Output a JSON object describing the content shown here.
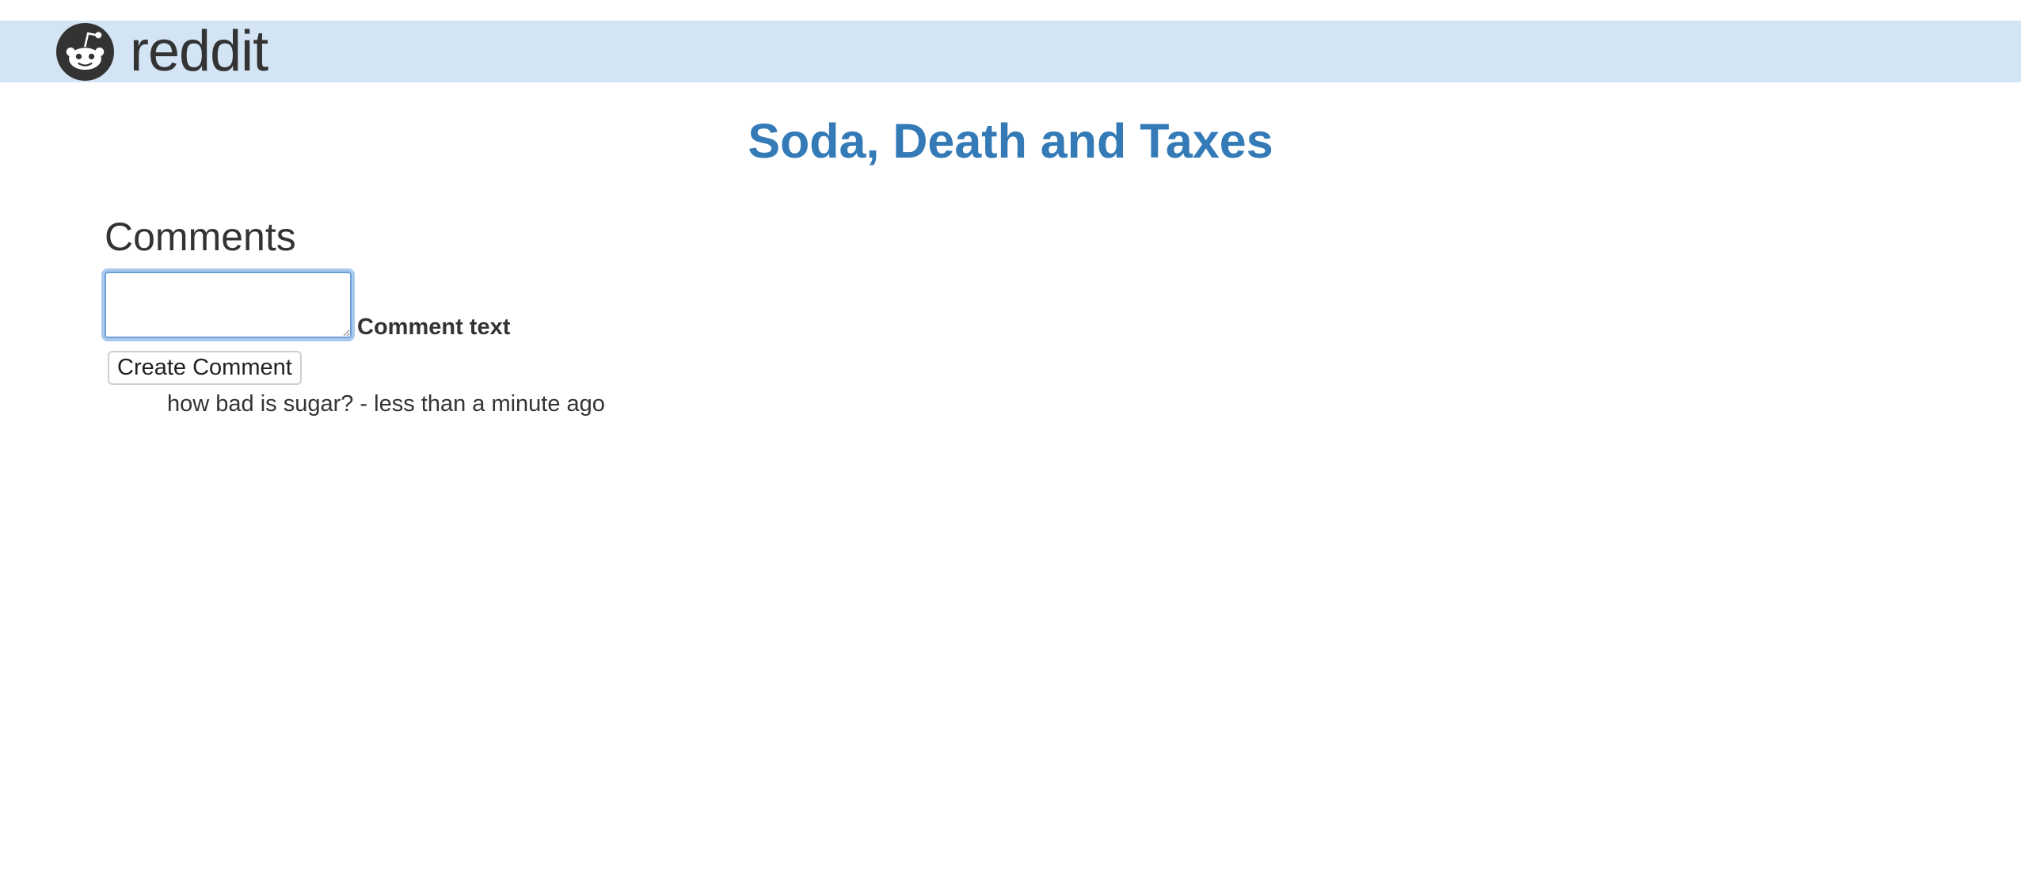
{
  "header": {
    "brand_name": "reddit",
    "logo_icon": "reddit-alien-icon",
    "background_color": "#d3e4f5"
  },
  "post": {
    "title": "Soda, Death and Taxes",
    "title_color": "#337ab7"
  },
  "comments": {
    "heading": "Comments",
    "textarea_value": "",
    "textarea_label": "Comment text",
    "submit_label": "Create Comment",
    "items": [
      {
        "text": "how bad is sugar? - less than a minute ago"
      }
    ]
  }
}
